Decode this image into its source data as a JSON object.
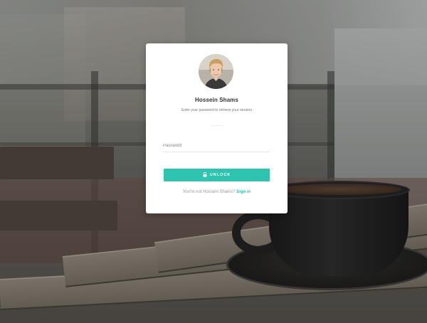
{
  "lock_screen": {
    "user_name": "Hossein Shams",
    "subtitle": "Enter your password to retrieve your session",
    "password_placeholder": "Password",
    "password_value": "",
    "unlock_label": "UNLOCK",
    "footer_text": "You're not Hossein Shams?",
    "sign_in_label": "Sign in"
  },
  "colors": {
    "accent": "#2ec4b0",
    "card_background": "#ffffff",
    "title_text": "#333333",
    "muted_text": "#999999"
  },
  "icons": {
    "unlock_button_icon": "lock-icon"
  }
}
